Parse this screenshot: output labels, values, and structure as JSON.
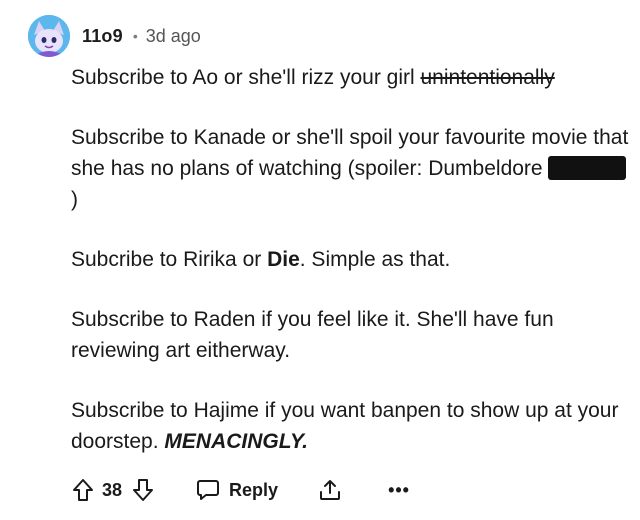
{
  "comment": {
    "author": "11o9",
    "separator": "•",
    "timestamp": "3d ago",
    "paragraphs": {
      "p1": {
        "text": "Subscribe to Ao or she'll rizz your girl ",
        "struck": "unintentionally"
      },
      "p2": {
        "text": "Subscribe to Kanade or she'll spoil your favourite movie that she has no plans of watching (spoiler: Dumbeldore ",
        "after_redaction": ")"
      },
      "p3": {
        "before": "Subcribe to Ririka or ",
        "bold": "Die",
        "after": ". Simple as that."
      },
      "p4": {
        "text": "Subscribe to Raden if you feel like it. She'll have fun reviewing art eitherway."
      },
      "p5": {
        "text": "Subscribe to Hajime if you want banpen to show up at your doorstep. ",
        "bold_italic": "MENACINGLY."
      }
    }
  },
  "actions": {
    "upvote_icon": "arrow-up-icon",
    "score": "38",
    "downvote_icon": "arrow-down-icon",
    "reply_icon": "speech-bubble-icon",
    "reply_label": "Reply",
    "share_icon": "share-icon",
    "more_label": "•••"
  },
  "colors": {
    "text": "#1a1a1b",
    "muted": "#7c7c7c",
    "avatar_bg": "#4aa6e0",
    "redaction": "#111111"
  }
}
